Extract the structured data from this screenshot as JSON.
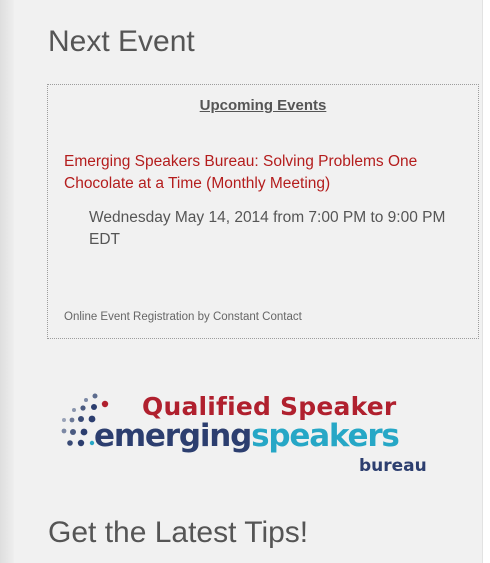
{
  "next_event": {
    "title": "Next Event",
    "box": {
      "heading": "Upcoming Events",
      "event_link": "Emerging Speakers Bureau: Solving Problems One Chocolate at a Time (Monthly Meeting)",
      "event_date": "Wednesday May 14, 2014 from 7:00 PM to 9:00 PM EDT",
      "footer": "Online Event Registration by Constant Contact"
    }
  },
  "logo": {
    "line1": "Qualified Speaker",
    "word_emerging": "emerging",
    "word_speakers": "speakers",
    "word_bureau": "bureau",
    "colors": {
      "red": "#b0202e",
      "navy": "#2c3e6f",
      "teal": "#26a7c6"
    }
  },
  "latest_tips": {
    "title": "Get the Latest Tips!"
  },
  "colors": {
    "sidebar_bg": "#f1f1f1",
    "heading_text": "#555555",
    "link_red": "#b41d1d"
  }
}
